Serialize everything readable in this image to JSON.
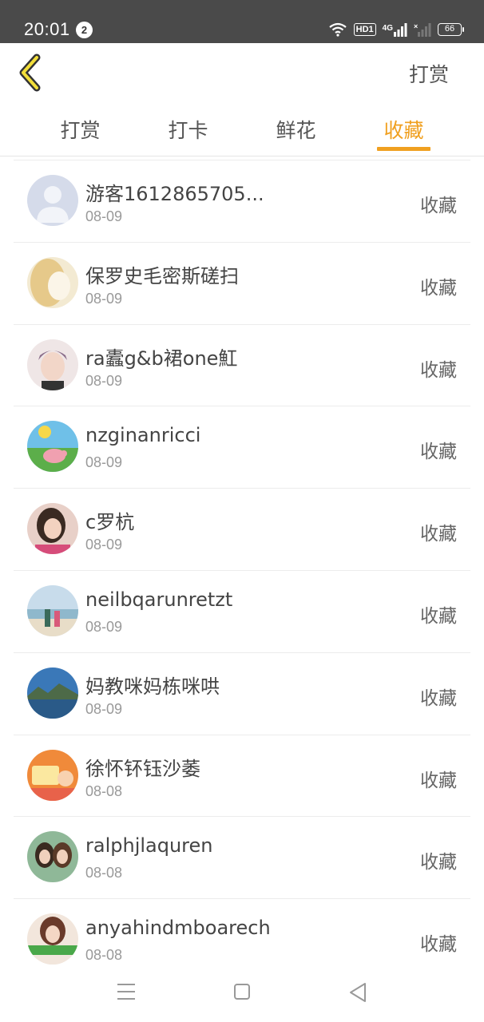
{
  "status_bar": {
    "time": "20:01",
    "notification_count": "2",
    "hd_label": "HD1",
    "network_label": "4G",
    "battery": "66"
  },
  "header": {
    "action_label": "打赏"
  },
  "tabs": [
    {
      "label": "打赏"
    },
    {
      "label": "打卡"
    },
    {
      "label": "鲜花"
    },
    {
      "label": "收藏"
    }
  ],
  "active_tab": "收藏",
  "accent_color": "#f0a020",
  "list": [
    {
      "name": "游客1612865705...",
      "date": "08-09",
      "kind": "收藏"
    },
    {
      "name": "保罗史毛密斯磋扫",
      "date": "08-09",
      "kind": "收藏"
    },
    {
      "name": "ra蠹g&b裙one魟",
      "date": "08-09",
      "kind": "收藏"
    },
    {
      "name": "nzginanricci",
      "date": "08-09",
      "kind": "收藏"
    },
    {
      "name": "c罗杭",
      "date": "08-09",
      "kind": "收藏"
    },
    {
      "name": "neilbqarunretzt",
      "date": "08-09",
      "kind": "收藏"
    },
    {
      "name": "妈教咪妈栋咪哄",
      "date": "08-09",
      "kind": "收藏"
    },
    {
      "name": "徐怀钚钰沙萎",
      "date": "08-08",
      "kind": "收藏"
    },
    {
      "name": "ralphjlaquren",
      "date": "08-08",
      "kind": "收藏"
    },
    {
      "name": "anyahindmboarech",
      "date": "08-08",
      "kind": "收藏"
    }
  ]
}
